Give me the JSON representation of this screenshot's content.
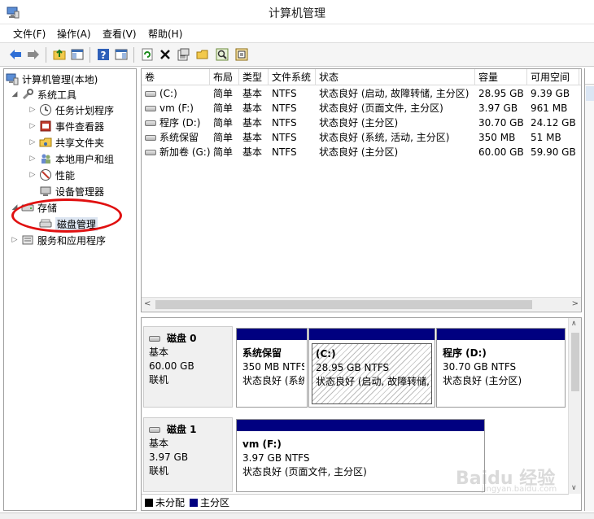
{
  "window": {
    "title": "计算机管理"
  },
  "menu": [
    "文件(F)",
    "操作(A)",
    "查看(V)",
    "帮助(H)"
  ],
  "toolbar": {
    "icons": [
      "back-icon",
      "forward-icon",
      "up-folder-icon",
      "show-hide-tree-icon",
      "help-icon",
      "show-hide-action-icon",
      "refresh-icon",
      "delete-icon",
      "properties-icon",
      "open-icon",
      "search-icon",
      "settings-icon"
    ]
  },
  "tree": {
    "root": "计算机管理(本地)",
    "items": [
      {
        "label": "系统工具"
      },
      {
        "label": "任务计划程序"
      },
      {
        "label": "事件查看器"
      },
      {
        "label": "共享文件夹"
      },
      {
        "label": "本地用户和组"
      },
      {
        "label": "性能"
      },
      {
        "label": "设备管理器"
      },
      {
        "label": "存储"
      },
      {
        "label": "磁盘管理"
      },
      {
        "label": "服务和应用程序"
      }
    ]
  },
  "volumes": {
    "columns": [
      "卷",
      "布局",
      "类型",
      "文件系统",
      "状态",
      "容量",
      "可用空间"
    ],
    "rows": [
      [
        "(C:)",
        "简单",
        "基本",
        "NTFS",
        "状态良好 (启动, 故障转储, 主分区)",
        "28.95 GB",
        "9.39 GB"
      ],
      [
        "vm (F:)",
        "简单",
        "基本",
        "NTFS",
        "状态良好 (页面文件, 主分区)",
        "3.97 GB",
        "961 MB"
      ],
      [
        "程序 (D:)",
        "简单",
        "基本",
        "NTFS",
        "状态良好 (主分区)",
        "30.70 GB",
        "24.12 GB"
      ],
      [
        "系统保留",
        "简单",
        "基本",
        "NTFS",
        "状态良好 (系统, 活动, 主分区)",
        "350 MB",
        "51 MB"
      ],
      [
        "新加卷 (G:)",
        "简单",
        "基本",
        "NTFS",
        "状态良好 (主分区)",
        "60.00 GB",
        "59.90 GB"
      ]
    ]
  },
  "disks": [
    {
      "name": "磁盘 0",
      "type": "基本",
      "size": "60.00 GB",
      "status": "联机",
      "partitions": [
        {
          "name": "系统保留",
          "size": "350 MB NTFS",
          "status": "状态良好 (系统"
        },
        {
          "name": "(C:)",
          "size": "28.95 GB NTFS",
          "status": "状态良好 (启动, 故障转储,"
        },
        {
          "name": "程序  (D:)",
          "size": "30.70 GB NTFS",
          "status": "状态良好 (主分区)"
        }
      ]
    },
    {
      "name": "磁盘 1",
      "type": "基本",
      "size": "3.97 GB",
      "status": "联机",
      "partitions": [
        {
          "name": "vm  (F:)",
          "size": "3.97 GB NTFS",
          "status": "状态良好 (页面文件, 主分区)"
        }
      ]
    }
  ],
  "legend": [
    {
      "label": "未分配",
      "color": "#000000"
    },
    {
      "label": "主分区",
      "color": "#000080"
    }
  ],
  "watermark": {
    "brand": "Baidu 经验",
    "url": "jingyan.baidu.com"
  }
}
